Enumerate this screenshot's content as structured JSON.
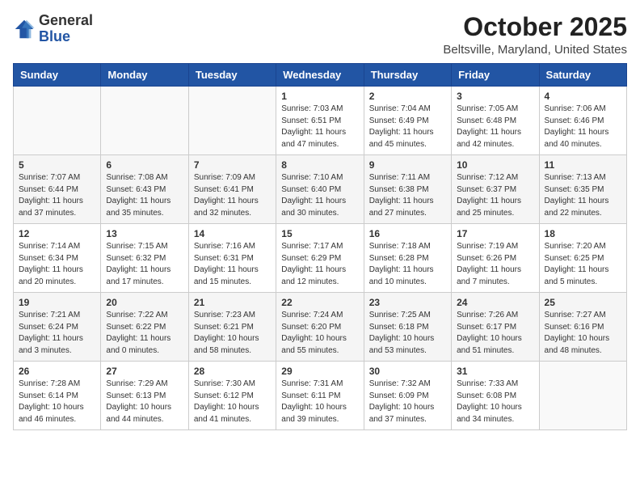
{
  "logo": {
    "text_general": "General",
    "text_blue": "Blue"
  },
  "title": "October 2025",
  "location": "Beltsville, Maryland, United States",
  "weekdays": [
    "Sunday",
    "Monday",
    "Tuesday",
    "Wednesday",
    "Thursday",
    "Friday",
    "Saturday"
  ],
  "weeks": [
    [
      {
        "day": "",
        "info": ""
      },
      {
        "day": "",
        "info": ""
      },
      {
        "day": "",
        "info": ""
      },
      {
        "day": "1",
        "info": "Sunrise: 7:03 AM\nSunset: 6:51 PM\nDaylight: 11 hours\nand 47 minutes."
      },
      {
        "day": "2",
        "info": "Sunrise: 7:04 AM\nSunset: 6:49 PM\nDaylight: 11 hours\nand 45 minutes."
      },
      {
        "day": "3",
        "info": "Sunrise: 7:05 AM\nSunset: 6:48 PM\nDaylight: 11 hours\nand 42 minutes."
      },
      {
        "day": "4",
        "info": "Sunrise: 7:06 AM\nSunset: 6:46 PM\nDaylight: 11 hours\nand 40 minutes."
      }
    ],
    [
      {
        "day": "5",
        "info": "Sunrise: 7:07 AM\nSunset: 6:44 PM\nDaylight: 11 hours\nand 37 minutes."
      },
      {
        "day": "6",
        "info": "Sunrise: 7:08 AM\nSunset: 6:43 PM\nDaylight: 11 hours\nand 35 minutes."
      },
      {
        "day": "7",
        "info": "Sunrise: 7:09 AM\nSunset: 6:41 PM\nDaylight: 11 hours\nand 32 minutes."
      },
      {
        "day": "8",
        "info": "Sunrise: 7:10 AM\nSunset: 6:40 PM\nDaylight: 11 hours\nand 30 minutes."
      },
      {
        "day": "9",
        "info": "Sunrise: 7:11 AM\nSunset: 6:38 PM\nDaylight: 11 hours\nand 27 minutes."
      },
      {
        "day": "10",
        "info": "Sunrise: 7:12 AM\nSunset: 6:37 PM\nDaylight: 11 hours\nand 25 minutes."
      },
      {
        "day": "11",
        "info": "Sunrise: 7:13 AM\nSunset: 6:35 PM\nDaylight: 11 hours\nand 22 minutes."
      }
    ],
    [
      {
        "day": "12",
        "info": "Sunrise: 7:14 AM\nSunset: 6:34 PM\nDaylight: 11 hours\nand 20 minutes."
      },
      {
        "day": "13",
        "info": "Sunrise: 7:15 AM\nSunset: 6:32 PM\nDaylight: 11 hours\nand 17 minutes."
      },
      {
        "day": "14",
        "info": "Sunrise: 7:16 AM\nSunset: 6:31 PM\nDaylight: 11 hours\nand 15 minutes."
      },
      {
        "day": "15",
        "info": "Sunrise: 7:17 AM\nSunset: 6:29 PM\nDaylight: 11 hours\nand 12 minutes."
      },
      {
        "day": "16",
        "info": "Sunrise: 7:18 AM\nSunset: 6:28 PM\nDaylight: 11 hours\nand 10 minutes."
      },
      {
        "day": "17",
        "info": "Sunrise: 7:19 AM\nSunset: 6:26 PM\nDaylight: 11 hours\nand 7 minutes."
      },
      {
        "day": "18",
        "info": "Sunrise: 7:20 AM\nSunset: 6:25 PM\nDaylight: 11 hours\nand 5 minutes."
      }
    ],
    [
      {
        "day": "19",
        "info": "Sunrise: 7:21 AM\nSunset: 6:24 PM\nDaylight: 11 hours\nand 3 minutes."
      },
      {
        "day": "20",
        "info": "Sunrise: 7:22 AM\nSunset: 6:22 PM\nDaylight: 11 hours\nand 0 minutes."
      },
      {
        "day": "21",
        "info": "Sunrise: 7:23 AM\nSunset: 6:21 PM\nDaylight: 10 hours\nand 58 minutes."
      },
      {
        "day": "22",
        "info": "Sunrise: 7:24 AM\nSunset: 6:20 PM\nDaylight: 10 hours\nand 55 minutes."
      },
      {
        "day": "23",
        "info": "Sunrise: 7:25 AM\nSunset: 6:18 PM\nDaylight: 10 hours\nand 53 minutes."
      },
      {
        "day": "24",
        "info": "Sunrise: 7:26 AM\nSunset: 6:17 PM\nDaylight: 10 hours\nand 51 minutes."
      },
      {
        "day": "25",
        "info": "Sunrise: 7:27 AM\nSunset: 6:16 PM\nDaylight: 10 hours\nand 48 minutes."
      }
    ],
    [
      {
        "day": "26",
        "info": "Sunrise: 7:28 AM\nSunset: 6:14 PM\nDaylight: 10 hours\nand 46 minutes."
      },
      {
        "day": "27",
        "info": "Sunrise: 7:29 AM\nSunset: 6:13 PM\nDaylight: 10 hours\nand 44 minutes."
      },
      {
        "day": "28",
        "info": "Sunrise: 7:30 AM\nSunset: 6:12 PM\nDaylight: 10 hours\nand 41 minutes."
      },
      {
        "day": "29",
        "info": "Sunrise: 7:31 AM\nSunset: 6:11 PM\nDaylight: 10 hours\nand 39 minutes."
      },
      {
        "day": "30",
        "info": "Sunrise: 7:32 AM\nSunset: 6:09 PM\nDaylight: 10 hours\nand 37 minutes."
      },
      {
        "day": "31",
        "info": "Sunrise: 7:33 AM\nSunset: 6:08 PM\nDaylight: 10 hours\nand 34 minutes."
      },
      {
        "day": "",
        "info": ""
      }
    ]
  ]
}
